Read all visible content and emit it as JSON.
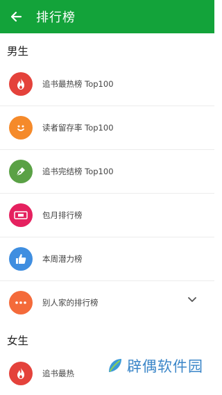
{
  "header": {
    "title": "排行榜",
    "back_icon": "back-arrow-icon",
    "bg_color": "#13a33a"
  },
  "sections": [
    {
      "title": "男生",
      "items": [
        {
          "label": "追书最热榜 Top100",
          "icon": "flame-icon",
          "color": "#e4423b"
        },
        {
          "label": "读者留存率 Top100",
          "icon": "smiley-icon",
          "color": "#f58a2a"
        },
        {
          "label": "追书完结榜 Top100",
          "icon": "pen-icon",
          "color": "#5aa145"
        },
        {
          "label": "包月排行榜",
          "icon": "ticket-icon",
          "color": "#e5215f"
        },
        {
          "label": "本周潜力榜",
          "icon": "thumbs-up-icon",
          "color": "#3f8ee0"
        },
        {
          "label": "别人家的排行榜",
          "icon": "more-dots-icon",
          "color": "#f46a3a"
        }
      ]
    },
    {
      "title": "女生",
      "items": [
        {
          "label": "追书最热",
          "icon": "flame-icon",
          "color": "#e4423b"
        }
      ]
    }
  ],
  "watermark": {
    "text": "辟偶软件园",
    "icon": "leaf-logo-icon"
  }
}
